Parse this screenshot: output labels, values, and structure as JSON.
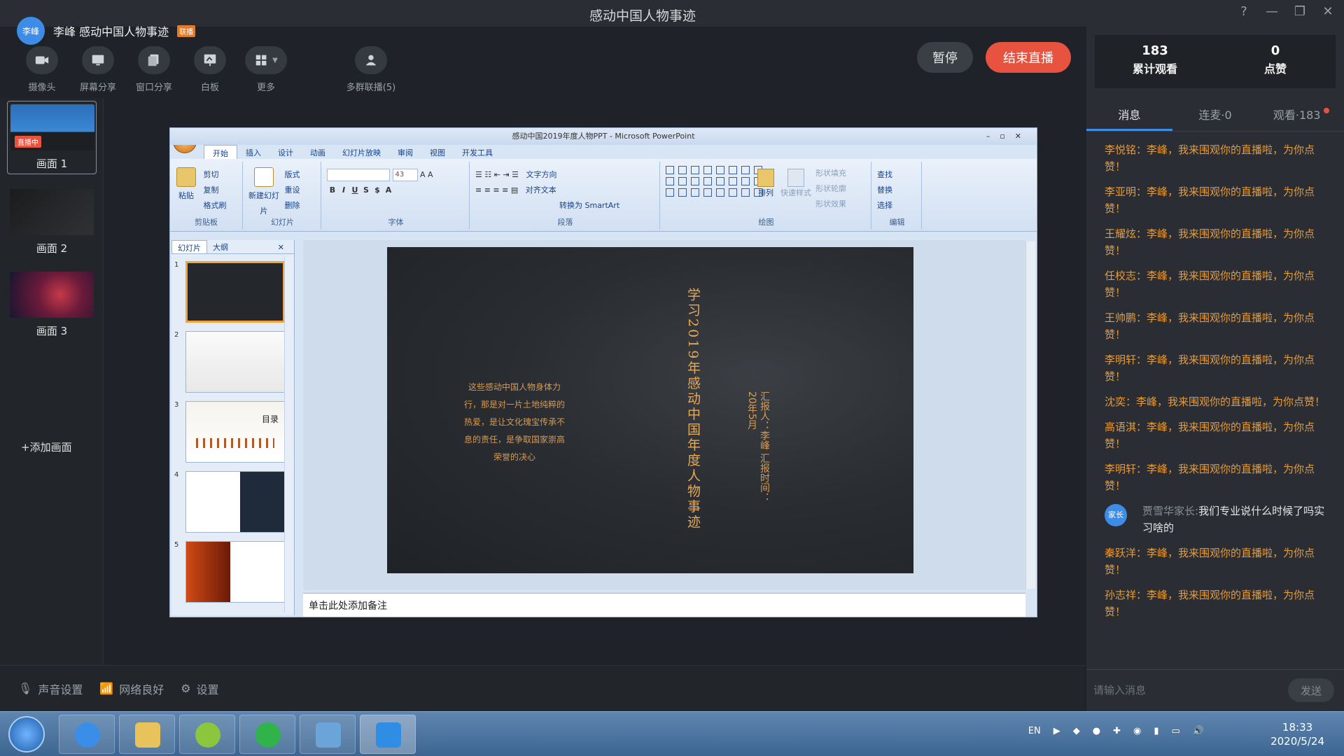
{
  "window": {
    "title": "感动中国人物事迹"
  },
  "user": {
    "avatar_text": "李峰",
    "name": "李峰 感动中国人物事迹",
    "tag": "联播"
  },
  "toolbar": {
    "tools": [
      {
        "label": "摄像头",
        "icon": "camera-icon"
      },
      {
        "label": "屏幕分享",
        "icon": "screen-share-icon"
      },
      {
        "label": "窗口分享",
        "icon": "window-share-icon"
      },
      {
        "label": "白板",
        "icon": "whiteboard-icon"
      },
      {
        "label": "更多",
        "icon": "more-icon"
      }
    ],
    "multi_label": "多群联播(5)",
    "pause_label": "暂停",
    "end_label": "结束直播"
  },
  "scenes": {
    "items": [
      {
        "label": "画面 1",
        "badge": "直播中"
      },
      {
        "label": "画面 2"
      },
      {
        "label": "画面 3"
      }
    ],
    "add_label": "+添加画面"
  },
  "ppt": {
    "title": "感动中国2019年度人物PPT - Microsoft PowerPoint",
    "tabs": [
      "开始",
      "插入",
      "设计",
      "动画",
      "幻灯片放映",
      "审阅",
      "视图",
      "开发工具"
    ],
    "groups": {
      "clipboard": {
        "name": "剪贴板",
        "paste": "粘贴",
        "cut": "剪切",
        "copy": "复制",
        "format": "格式刷"
      },
      "slides": {
        "name": "幻灯片",
        "new": "新建幻灯片",
        "layout": "版式",
        "reset": "重设",
        "delete": "删除"
      },
      "font": {
        "name": "字体",
        "size": "43"
      },
      "paragraph": {
        "name": "段落",
        "text_dir": "文字方向",
        "align_text": "对齐文本",
        "smartart": "转换为 SmartArt"
      },
      "drawing": {
        "name": "绘图",
        "arrange": "排列",
        "quick_styles": "快速样式",
        "fill": "形状填充",
        "outline": "形状轮廓",
        "effects": "形状效果"
      },
      "editing": {
        "name": "编辑",
        "find": "查找",
        "replace": "替换",
        "select": "选择"
      }
    },
    "pane_tabs": [
      "幻灯片",
      "大纲"
    ],
    "slide_numbers": [
      "1",
      "2",
      "3",
      "4",
      "5"
    ],
    "thumb3_text": "目录",
    "slide": {
      "title": "学习2019年感动中国年度人物事迹",
      "reporter": "汇报人：李峰",
      "report_time": "汇报时间：20年5月",
      "paragraph": "这些感动中国人物身体力行，那是对一片土地纯粹的热爱，是让文化瑰宝传承不息的责任，是争取国家崇高荣誉的决心"
    },
    "notes_placeholder": "单击此处添加备注"
  },
  "stats": {
    "views": "183",
    "views_label": "累计观看",
    "likes": "0",
    "likes_label": "点赞"
  },
  "right_tabs": {
    "messages": "消息",
    "connect": "连麦·0",
    "viewers": "观看·183"
  },
  "messages": [
    {
      "text": "李悦铭：李峰，我来围观你的直播啦，为你点赞！"
    },
    {
      "text": "李亚明：李峰，我来围观你的直播啦，为你点赞！"
    },
    {
      "text": "王耀炫：李峰，我来围观你的直播啦，为你点赞！"
    },
    {
      "text": "任校志：李峰，我来围观你的直播啦，为你点赞！"
    },
    {
      "text": "王帅鹏：李峰，我来围观你的直播啦，为你点赞！"
    },
    {
      "text": "李明轩：李峰，我来围观你的直播啦，为你点赞！"
    },
    {
      "text": "沈奕：李峰，我来围观你的直播啦，为你点赞！"
    },
    {
      "text": "高语淇：李峰，我来围观你的直播啦，为你点赞！"
    },
    {
      "text": "李明轩：李峰，我来围观你的直播啦，为你点赞！"
    }
  ],
  "chat": {
    "avatar": "家长",
    "who": "贾雪华家长:",
    "text": "我们专业说什么时候了吗实习啥的"
  },
  "messages_after": [
    {
      "text": "秦跃洋：李峰，我来围观你的直播啦，为你点赞！"
    },
    {
      "text": "孙志祥：李峰，我来围观你的直播啦，为你点赞！"
    }
  ],
  "input": {
    "placeholder": "请输入消息",
    "send": "发送"
  },
  "status": {
    "audio": "声音设置",
    "network": "网络良好",
    "settings": "设置"
  },
  "taskbar": {
    "lang": "EN",
    "time": "18:33",
    "date": "2020/5/24"
  }
}
